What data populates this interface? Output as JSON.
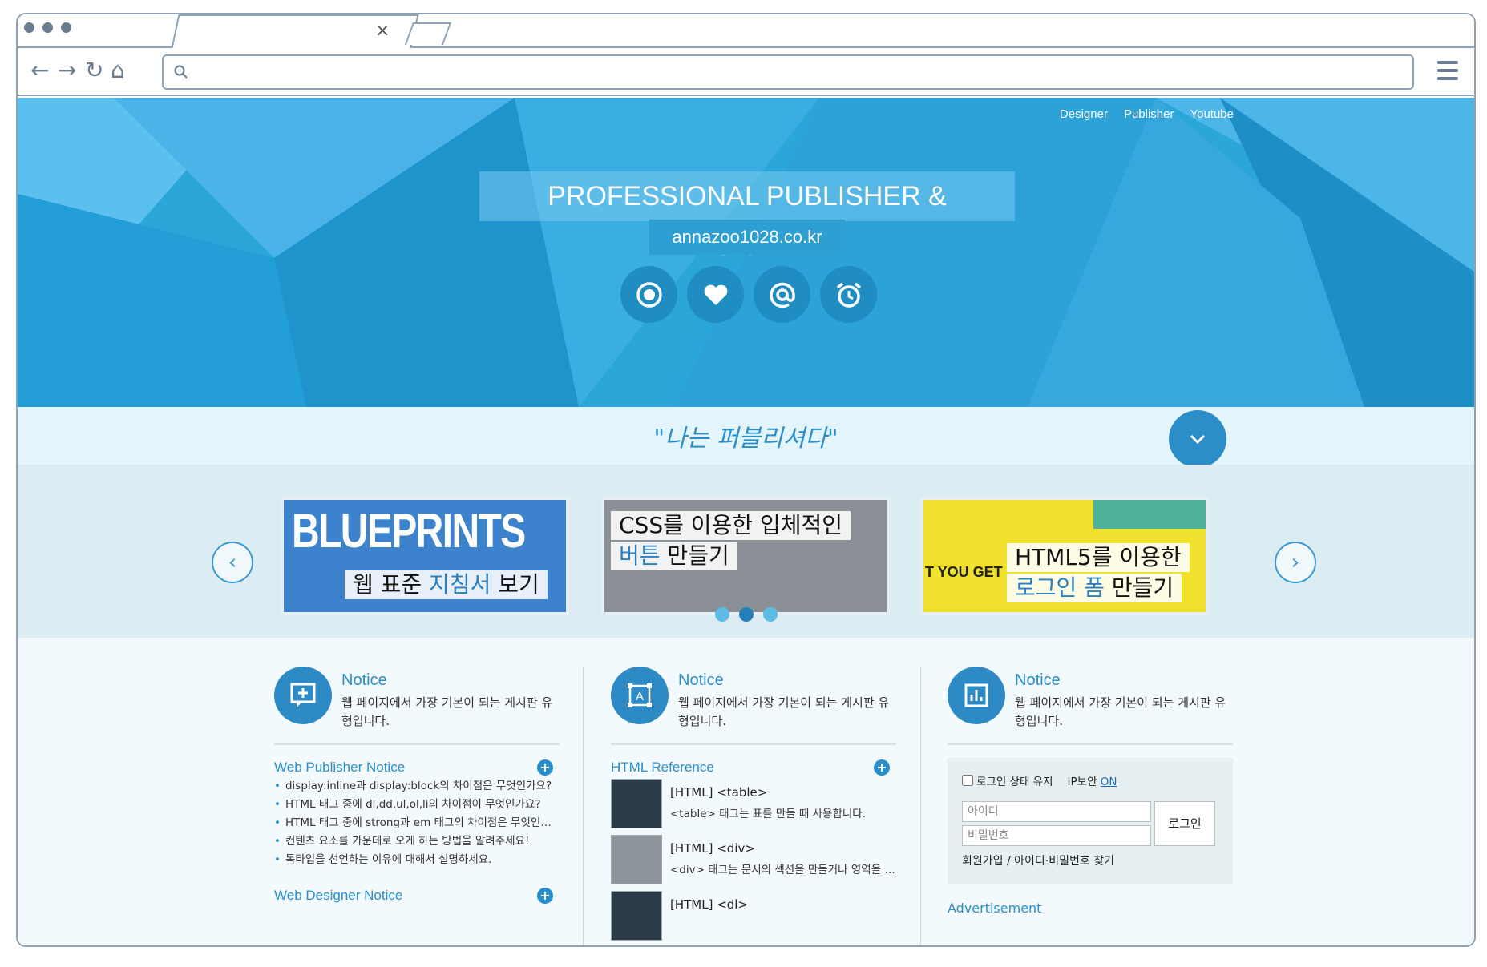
{
  "browser": {
    "tab_title": "",
    "tab_close": "×",
    "nav": {
      "back": "←",
      "forward": "→",
      "reload": "↻",
      "home": "⌂"
    },
    "url": ""
  },
  "hero": {
    "nav": [
      "Designer",
      "Publisher",
      "Youtube"
    ],
    "title": "PROFESSIONAL PUBLISHER & DESIGNER",
    "domain": "annazoo1028.co.kr",
    "icons": [
      "target-icon",
      "heart-icon",
      "at-icon",
      "alarm-clock-icon"
    ]
  },
  "slogan": {
    "text": "\"나는 퍼블리셔다\"",
    "down": "⌄"
  },
  "slider": {
    "prev": "‹",
    "next": "›",
    "cards": [
      {
        "big": "BLUEPRINTS",
        "cap_a": "웹 표준 ",
        "cap_hl": "지침서",
        "cap_b": " 보기"
      },
      {
        "line1": "CSS를 이용한 입체적인",
        "line2_hl": "버튼",
        "line2_b": " 만들기"
      },
      {
        "tag": "T YOU GET",
        "line1": "HTML5를 이용한",
        "line2_hl": "로그인 폼",
        "line2_b": " 만들기"
      }
    ],
    "active_page": 2,
    "page_count": 3
  },
  "columns": [
    {
      "title": "Notice",
      "desc": "웹 페이지에서 가장 기본이 되는 게시판 유형입니다.",
      "section1": "Web Publisher Notice",
      "notices": [
        "display:inline과 display:block의 차이점은 무엇인가요?",
        "HTML 태그 중에 dl,dd,ul,ol,li의 차이점이 무엇인가요?",
        "HTML 태그 중에 strong과 em 태그의 차이점은 무엇인가요?",
        "컨텐츠 요소를 가운데로 오게 하는 방법을 알려주세요!",
        "독타입을 선언하는 이유에 대해서 설명하세요."
      ],
      "section2": "Web Designer Notice"
    },
    {
      "title": "Notice",
      "desc": "웹 페이지에서 가장 기본이 되는 게시판 유형입니다.",
      "section1": "HTML Reference",
      "refs": [
        {
          "title": "[HTML] <table>",
          "desc": "<table> 태그는 표를 만들 때 사용합니다."
        },
        {
          "title": "[HTML] <div>",
          "desc": "<div> 태그는 문서의 섹션을 만들거나 영역을 나눌 때 사용합니다."
        },
        {
          "title": "[HTML] <dl>",
          "desc": ""
        }
      ]
    },
    {
      "title": "Notice",
      "desc": "웹 페이지에서 가장 기본이 되는 게시판 유형입니다.",
      "login": {
        "keep": "로그인 상태 유지",
        "ip_label": "IP보안",
        "ip_value": "ON",
        "id_placeholder": "아이디",
        "pw_placeholder": "비밀번호",
        "button": "로그인",
        "links": "회원가입 / 아이디·비밀번호 찾기"
      },
      "ad": "Advertisement"
    }
  ],
  "colors": {
    "hero": "#2aa6d9",
    "accent": "#2a8ec8",
    "panel": "#f3fafd"
  }
}
